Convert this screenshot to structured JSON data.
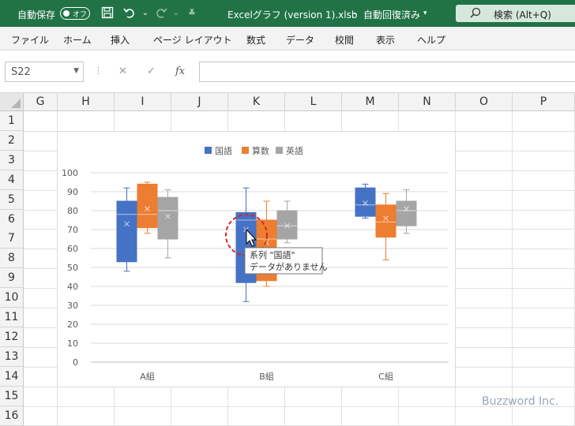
{
  "titlebar": {
    "autosave_label": "自動保存",
    "autosave_state": "オフ",
    "filename": "Excelグラフ (version 1).xlsb",
    "separator": "-",
    "save_status": "自動回復済み",
    "search_label": "検索 (Alt+Q)"
  },
  "menu": [
    "ファイル",
    "ホーム",
    "挿入",
    "ページ レイアウト",
    "数式",
    "データ",
    "校閲",
    "表示",
    "ヘルプ"
  ],
  "formula_bar": {
    "name_box": "S22",
    "formula_value": ""
  },
  "columns": [
    "G",
    "H",
    "I",
    "J",
    "K",
    "L",
    "M",
    "N",
    "O",
    "P"
  ],
  "rows": [
    "1",
    "2",
    "3",
    "4",
    "5",
    "6",
    "7",
    "8",
    "9",
    "10",
    "11",
    "12",
    "13",
    "14",
    "15",
    "16"
  ],
  "colors": {
    "title_bar": "#217346",
    "series_1": "#4472c4",
    "series_2": "#ed7d31",
    "series_3": "#a5a5a5",
    "focus_circle": "#d62728"
  },
  "chart_data": {
    "type": "boxplot",
    "categories": [
      "A組",
      "B組",
      "C組"
    ],
    "ylim": [
      0,
      100
    ],
    "yticks": [
      0,
      10,
      20,
      30,
      40,
      50,
      60,
      70,
      80,
      90,
      100
    ],
    "legend_position": "top",
    "grid": true,
    "series": [
      {
        "name": "国語",
        "color": "#4472c4",
        "boxes": [
          {
            "min": 48,
            "q1": 53,
            "median": 78,
            "q3": 85,
            "max": 92,
            "mean": 73
          },
          {
            "min": 32,
            "q1": 42,
            "median": 75,
            "q3": 79,
            "max": 92,
            "mean": 70
          },
          {
            "min": 76,
            "q1": 77,
            "median": 83,
            "q3": 92,
            "max": 94,
            "mean": 84
          }
        ]
      },
      {
        "name": "算数",
        "color": "#ed7d31",
        "boxes": [
          {
            "min": 68,
            "q1": 71,
            "median": 78,
            "q3": 94,
            "max": 95,
            "mean": 81
          },
          {
            "min": 40,
            "q1": 43,
            "median": 65,
            "q3": 75,
            "max": 85,
            "mean": 63
          },
          {
            "min": 54,
            "q1": 66,
            "median": 74,
            "q3": 83,
            "max": 89,
            "mean": 76
          }
        ]
      },
      {
        "name": "英語",
        "color": "#a5a5a5",
        "boxes": [
          {
            "min": 55,
            "q1": 65,
            "median": 80,
            "q3": 87,
            "max": 91,
            "mean": 77
          },
          {
            "min": 63,
            "q1": 65,
            "median": 72,
            "q3": 80,
            "max": 85,
            "mean": 72
          },
          {
            "min": 68,
            "q1": 72,
            "median": 80,
            "q3": 85,
            "max": 91,
            "mean": 81
          }
        ]
      }
    ]
  },
  "tooltip": {
    "line1": "系列 \"国語\"",
    "line2": "データがありません"
  },
  "watermark": "Buzzword Inc."
}
